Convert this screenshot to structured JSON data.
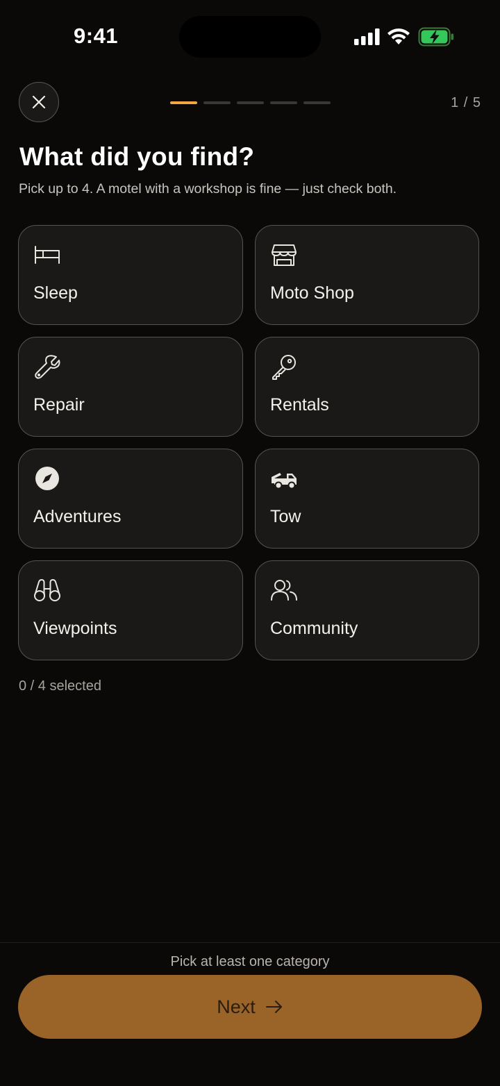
{
  "status_bar": {
    "time": "9:41"
  },
  "header": {
    "progress": {
      "total": 5,
      "current": 1
    },
    "step_label": "1 / 5"
  },
  "title": "What did you find?",
  "subtitle": "Pick up to 4. A motel with a workshop is fine — just check both.",
  "categories": [
    {
      "label": "Sleep",
      "icon": "bed-icon"
    },
    {
      "label": "Moto Shop",
      "icon": "storefront-icon"
    },
    {
      "label": "Repair",
      "icon": "wrench-icon"
    },
    {
      "label": "Rentals",
      "icon": "key-icon"
    },
    {
      "label": "Adventures",
      "icon": "compass-icon"
    },
    {
      "label": "Tow",
      "icon": "tow-truck-icon"
    },
    {
      "label": "Viewpoints",
      "icon": "binoculars-icon"
    },
    {
      "label": "Community",
      "icon": "users-icon"
    }
  ],
  "selection_count": "0 / 4 selected",
  "footer": {
    "hint": "Pick at least one category",
    "next_label": "Next"
  },
  "colors": {
    "accent": "#f2a541",
    "button": "#9a6328",
    "card_bg": "#1b1918",
    "page_bg": "#0a0908"
  }
}
